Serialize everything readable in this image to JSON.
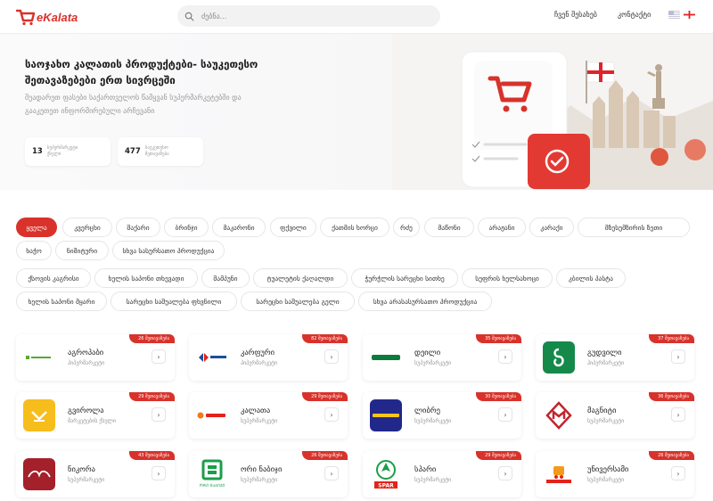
{
  "header": {
    "logo_text": "eKalata",
    "search_placeholder": "ძებნა...",
    "nav": {
      "about": "ჩვენ შესახებ",
      "contact": "კონტაქტი"
    }
  },
  "hero": {
    "title": "საოჯახო კალათის პროდუქტები- საუკეთესო შეთავაზებები ერთ სივრცეში",
    "subtitle": "შეადარეთ ფასები საქართველოს წამყვან სუპერმარკეტებში და გააკეთეთ ინფორმირებული არჩევანი",
    "stats": [
      {
        "value": "13",
        "label": "სუპერმარკეტი ქსელი"
      },
      {
        "value": "477",
        "label": "საუკეთესო შეთავაზება"
      }
    ]
  },
  "categories_row1": [
    "ყველა",
    "კვერცხი",
    "შაქარი",
    "ბრინჯი",
    "მაკარონი",
    "ფქვილი",
    "ქათმის ხორცი",
    "რძე",
    "მაწონი",
    "არაჟანი",
    "კარაქი",
    "მზესუმზირის ზეთი",
    "ხაჭო",
    "ნიშიტური",
    "სხვა სასურსათო პროდუქცია"
  ],
  "categories_row2": [
    "ქსოვის კაგრისი",
    "ხელის საპონი თხევადი",
    "შამპუნი",
    "ტუალეტის ქაღალდი",
    "ჭურჭლის სარეცხი სითხე",
    "სუფრის ხელსახოცი",
    "კბილის პასტა",
    "ხელის საპონი მყარი",
    "სარეცხი საშუალება ფხვნილი",
    "სარეცხი საშუალება გელი",
    "სხვა არასასურსათო პროდუქცია"
  ],
  "stores": [
    {
      "name": "აგროპაბი",
      "type": "ჰიპერმარკეტი",
      "badge": "26 შეთავაზება",
      "logo": "agrohub"
    },
    {
      "name": "კარფური",
      "type": "ჰიპერმარკეტი",
      "badge": "82 შეთავაზება",
      "logo": "carrefour"
    },
    {
      "name": "დეილი",
      "type": "სუპერმარკეტი",
      "badge": "35 შეთავაზება",
      "logo": "daily"
    },
    {
      "name": "გუდვილი",
      "type": "ჰიპერმარკეტი",
      "badge": "37 შეთავაზება",
      "logo": "goodwill"
    },
    {
      "name": "გვიროლა",
      "type": "მარკეტების ქსელი",
      "badge": "29 შეთავაზება",
      "logo": "gvirila"
    },
    {
      "name": "კალათა",
      "type": "სუპერმარკეტი",
      "badge": "29 შეთავაზება",
      "logo": "kalata"
    },
    {
      "name": "ლიბრე",
      "type": "სუპერმარკეტი",
      "badge": "30 შეთავაზება",
      "logo": "libre"
    },
    {
      "name": "მაგნიტი",
      "type": "სუპერმარკეტი",
      "badge": "36 შეთავაზება",
      "logo": "magniti"
    },
    {
      "name": "ნიკორა",
      "type": "სუპერმარკეტი",
      "badge": "43 შეთავაზება",
      "logo": "nikora"
    },
    {
      "name": "ორი ნაბიჯი",
      "type": "სუპერმარკეტი",
      "badge": "26 შეთავაზება",
      "logo": "ori-nabiji",
      "logo_text": "ᲝᲠᲘ ᲜᲐᲑᲘᲯᲘ"
    },
    {
      "name": "სპარი",
      "type": "სუპერმარკეტი",
      "badge": "29 შეთავაზება",
      "logo": "spar",
      "logo_text": "SPAR"
    },
    {
      "name": "უნივერსამი",
      "type": "სუპერმარკეტი",
      "badge": "26 შეთავაზება",
      "logo": "universami"
    }
  ],
  "colors": {
    "accent": "#d8322b"
  }
}
